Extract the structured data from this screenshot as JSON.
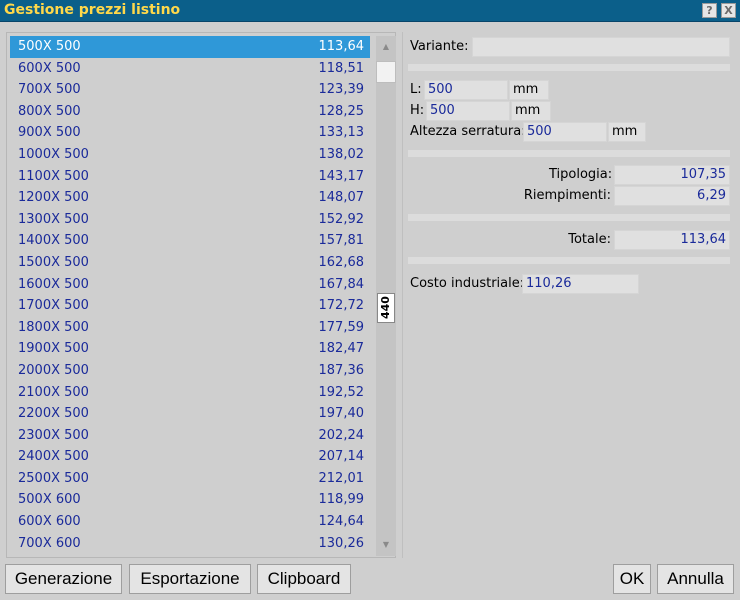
{
  "window": {
    "title": "Gestione prezzi listino",
    "help_label": "?",
    "close_label": "X"
  },
  "list": {
    "scroll_count": "440",
    "scroll_up": "▲",
    "scroll_down": "▼",
    "rows": [
      {
        "label": "500X 500",
        "value": "113,64"
      },
      {
        "label": "600X 500",
        "value": "118,51"
      },
      {
        "label": "700X 500",
        "value": "123,39"
      },
      {
        "label": "800X 500",
        "value": "128,25"
      },
      {
        "label": "900X 500",
        "value": "133,13"
      },
      {
        "label": "1000X 500",
        "value": "138,02"
      },
      {
        "label": "1100X 500",
        "value": "143,17"
      },
      {
        "label": "1200X 500",
        "value": "148,07"
      },
      {
        "label": "1300X 500",
        "value": "152,92"
      },
      {
        "label": "1400X 500",
        "value": "157,81"
      },
      {
        "label": "1500X 500",
        "value": "162,68"
      },
      {
        "label": "1600X 500",
        "value": "167,84"
      },
      {
        "label": "1700X 500",
        "value": "172,72"
      },
      {
        "label": "1800X 500",
        "value": "177,59"
      },
      {
        "label": "1900X 500",
        "value": "182,47"
      },
      {
        "label": "2000X 500",
        "value": "187,36"
      },
      {
        "label": "2100X 500",
        "value": "192,52"
      },
      {
        "label": "2200X 500",
        "value": "197,40"
      },
      {
        "label": "2300X 500",
        "value": "202,24"
      },
      {
        "label": "2400X 500",
        "value": "207,14"
      },
      {
        "label": "2500X 500",
        "value": "212,01"
      },
      {
        "label": "500X 600",
        "value": "118,99"
      },
      {
        "label": "600X 600",
        "value": "124,64"
      },
      {
        "label": "700X 600",
        "value": "130,26"
      }
    ]
  },
  "detail": {
    "variante_label": "Variante:",
    "variante_value": "",
    "l_label": "L:",
    "l_value": "500",
    "l_unit": "mm",
    "h_label": "H:",
    "h_value": "500",
    "h_unit": "mm",
    "altezza_label": "Altezza serratura:",
    "altezza_value": "500",
    "altezza_unit": "mm",
    "tipologia_label": "Tipologia:",
    "tipologia_value": "107,35",
    "riempimenti_label": "Riempimenti:",
    "riempimenti_value": "6,29",
    "totale_label": "Totale:",
    "totale_value": "113,64",
    "costo_label": "Costo industriale:",
    "costo_value": "110,26"
  },
  "buttons": {
    "generazione": "Generazione",
    "esportazione": "Esportazione",
    "clipboard": "Clipboard",
    "ok": "OK",
    "annulla": "Annulla"
  },
  "colors": {
    "titlebar": "#0b5f8a",
    "title_text": "#ffd84a",
    "selection": "#2f98d8",
    "value_text": "#1a2a9a"
  }
}
